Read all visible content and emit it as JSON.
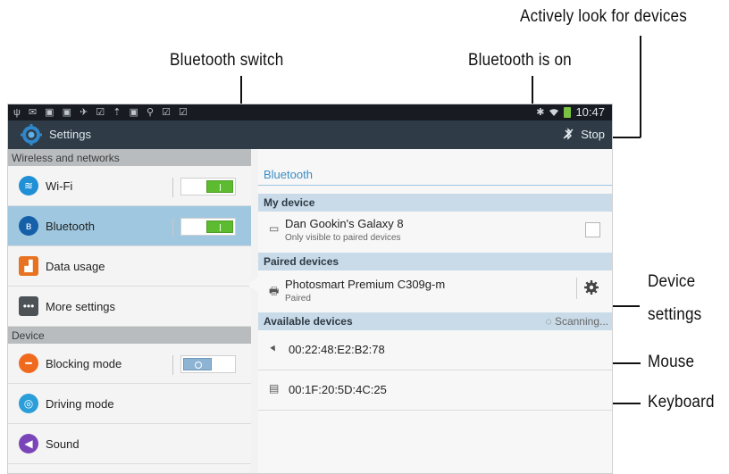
{
  "callouts": {
    "actively_look": "Actively look for devices",
    "bluetooth_switch": "Bluetooth switch",
    "bluetooth_on": "Bluetooth is on",
    "device_settings_1": "Device",
    "device_settings_2": "settings",
    "mouse": "Mouse",
    "keyboard": "Keyboard"
  },
  "statusbar": {
    "left_icons": "ψ ✉ ▣ ▣ ✈ ☑ ⇡ ▣ ⚲ ☑ ☑",
    "time": "10:47",
    "bt_icon": "bluetooth-icon",
    "wifi_icon": "wifi-signal-icon"
  },
  "actionbar": {
    "title": "Settings",
    "stop_label": "Stop",
    "icon": "settings-gear-icon"
  },
  "left": {
    "sections": [
      {
        "header": "Wireless and networks"
      },
      {
        "header": "Device"
      }
    ],
    "items": [
      {
        "label": "Wi-Fi",
        "icon": "wifi-icon",
        "color": "#1f8fd6",
        "switch": "on"
      },
      {
        "label": "Bluetooth",
        "icon": "bluetooth-icon",
        "color": "#1560a8",
        "switch": "on",
        "selected": true
      },
      {
        "label": "Data usage",
        "icon": "data-usage-icon",
        "color": "#e77322"
      },
      {
        "label": "More settings",
        "icon": "more-icon",
        "color": "#4d5257"
      },
      {
        "label": "Blocking mode",
        "icon": "blocking-mode-icon",
        "color": "#f06a1e",
        "switch": "off"
      },
      {
        "label": "Driving mode",
        "icon": "driving-mode-icon",
        "color": "#2a9ed9"
      },
      {
        "label": "Sound",
        "icon": "sound-icon",
        "color": "#7a45b8"
      }
    ]
  },
  "right": {
    "title": "Bluetooth",
    "my_device_header": "My device",
    "my_device_name": "Dan Gookin's Galaxy 8",
    "my_device_sub": "Only visible to paired devices",
    "paired_header": "Paired devices",
    "paired_name": "Photosmart Premium C309g-m",
    "paired_sub": "Paired",
    "available_header": "Available devices",
    "scanning": "Scanning...",
    "available": [
      {
        "name": "00:22:48:E2:B2:78",
        "icon": "mouse-icon"
      },
      {
        "name": "00:1F:20:5D:4C:25",
        "icon": "keyboard-icon"
      }
    ]
  }
}
